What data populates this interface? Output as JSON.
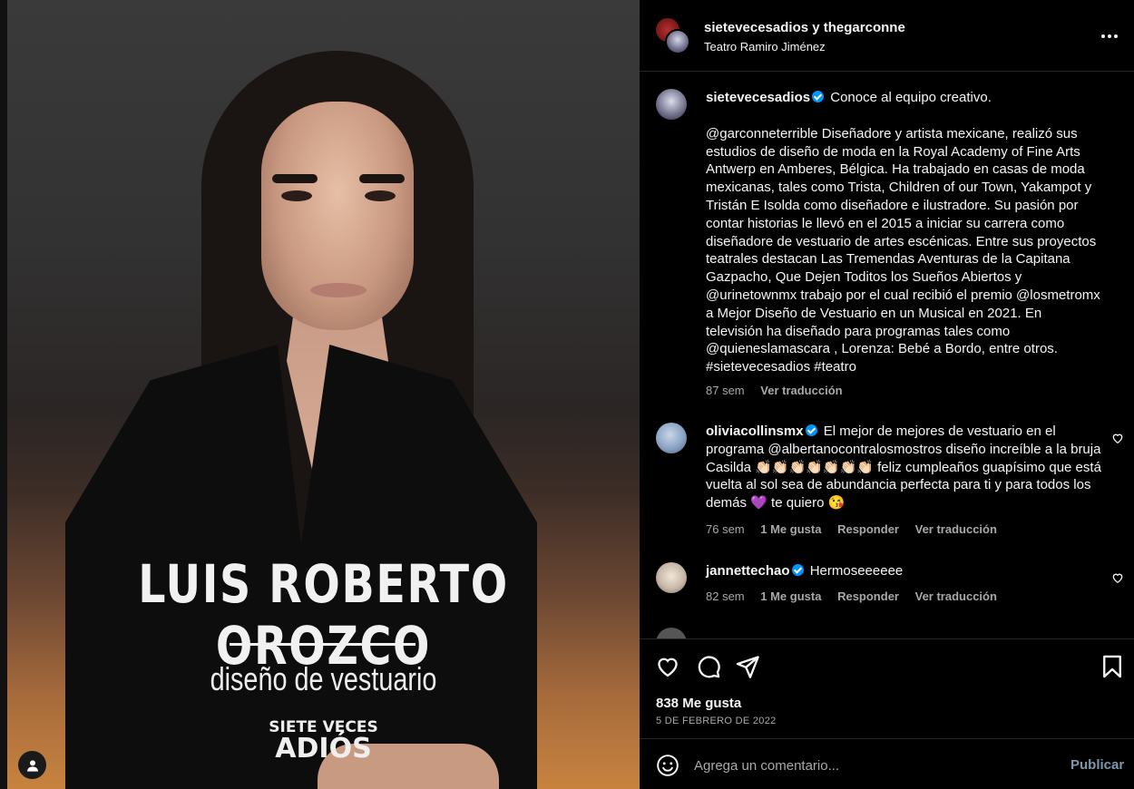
{
  "media": {
    "poster_title": "LUIS ROBERTO OROZCO",
    "poster_subtitle": "diseño de vestuario",
    "poster_logo_line1": "SIETE VECES",
    "poster_logo_line2": "ADIÓS",
    "tag_icon": "user-tag-icon"
  },
  "header": {
    "user1": "sietevecesadios",
    "joiner": " y ",
    "user2": "thegarconne",
    "location": "Teatro Ramiro Jiménez",
    "more_icon": "more-horizontal-icon"
  },
  "caption": {
    "username": "sietevecesadios",
    "text_intro": "Conoce al equipo creativo.",
    "text_body": "@garconneterrible Diseñadore y artista mexicane, realizó sus estudios de diseño de moda en la Royal Academy of Fine Arts Antwerp en Amberes, Bélgica. Ha trabajado en casas de moda mexicanas, tales como Trista, Children of our Town, Yakampot y Tristán E Isolda como diseñadore e ilustradore. Su pasión por contar historias le llevó en el 2015 a iniciar su carrera como diseñadore de vestuario de artes escénicas. Entre sus proyectos teatrales destacan Las Tremendas Aventuras de la Capitana Gazpacho, Que Dejen Toditos los Sueños Abiertos y @urinetownmx trabajo por el cual recibió el premio @losmetromx a Mejor Diseño de Vestuario en un Musical en 2021. En televisión ha diseñado para programas tales como @quieneslamascara , Lorenza: Bebé a Bordo, entre otros. #sietevecesadios #teatro",
    "time": "87 sem",
    "translate": "Ver traducción"
  },
  "comments": [
    {
      "username": "oliviacollinsmx",
      "text": "El mejor de mejores de vestuario en el programa @albertanocontralosmostros diseño increíble a la bruja Casilda 👏🏻👏🏻👏🏻👏🏻👏🏻👏🏻👏🏻 feliz cumpleaños guapísimo que está vuelta al sol sea de abundancia perfecta para ti y para todos los demás 💜  te quiero 😘",
      "time": "76 sem",
      "likes": "1 Me gusta",
      "reply": "Responder",
      "translate": "Ver traducción"
    },
    {
      "username": "jannettechao",
      "text": "Hermoseeeeee",
      "time": "82 sem",
      "likes": "1 Me gusta",
      "reply": "Responder",
      "translate": "Ver traducción"
    }
  ],
  "actions": {
    "like_icon": "heart-icon",
    "comment_icon": "comment-icon",
    "share_icon": "send-icon",
    "save_icon": "bookmark-icon",
    "likes_count": "838 Me gusta",
    "date": "5 DE FEBRERO DE 2022"
  },
  "comment_box": {
    "emoji_icon": "emoji-icon",
    "placeholder": "Agrega un comentario...",
    "publish_label": "Publicar"
  }
}
